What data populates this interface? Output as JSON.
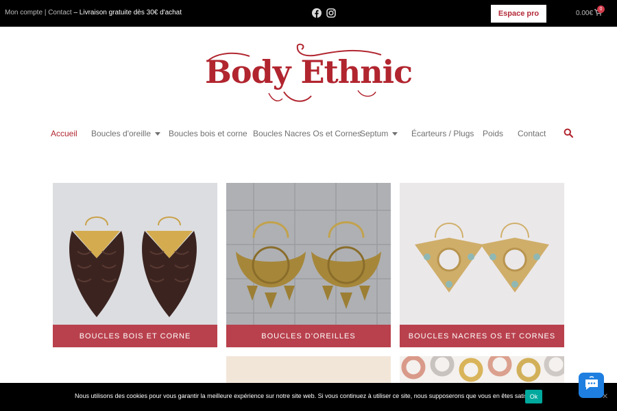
{
  "topbar": {
    "account_link": "Mon compte",
    "separator": "|",
    "contact_link": "Contact",
    "dash": "–",
    "shipping_note": "Livraison gratuite dès 30€ d'achat",
    "social_icons": [
      "facebook-icon",
      "instagram-icon"
    ],
    "pro_button": "Espace pro",
    "cart_total": "0.00€",
    "cart_count": "0"
  },
  "logo": {
    "text": "Body Ethnic"
  },
  "nav": {
    "items": [
      {
        "label": "Accueil",
        "active": true,
        "dropdown": false
      },
      {
        "label": "Boucles d'oreille",
        "active": false,
        "dropdown": true
      },
      {
        "label": "Boucles bois et corne",
        "active": false,
        "dropdown": false
      },
      {
        "label": "Boucles Nacres Os et Cornes",
        "active": false,
        "dropdown": false
      },
      {
        "label": "Septum",
        "active": false,
        "dropdown": true
      },
      {
        "label": "Écarteurs / Plugs",
        "active": false,
        "dropdown": false
      },
      {
        "label": "Poids",
        "active": false,
        "dropdown": false
      },
      {
        "label": "Contact",
        "active": false,
        "dropdown": false
      }
    ],
    "search_icon": "search-icon"
  },
  "categories": [
    {
      "label": "BOUCLES BOIS ET CORNE"
    },
    {
      "label": "BOUCLES D'OREILLES"
    },
    {
      "label": "BOUCLES NACRES OS ET CORNES"
    }
  ],
  "cookie": {
    "message": "Nous utilisons des cookies pour vous garantir la meilleure expérience sur notre site web. Si vous continuez à utiliser ce site, nous supposerons que vous en êtes satisfait.",
    "ok_label": "Ok",
    "close_label": "✕"
  },
  "colors": {
    "brand": "#b1252f",
    "category_bar": "#b8414d",
    "cookie_ok": "#00a99d",
    "chat": "#1e7fe0"
  }
}
